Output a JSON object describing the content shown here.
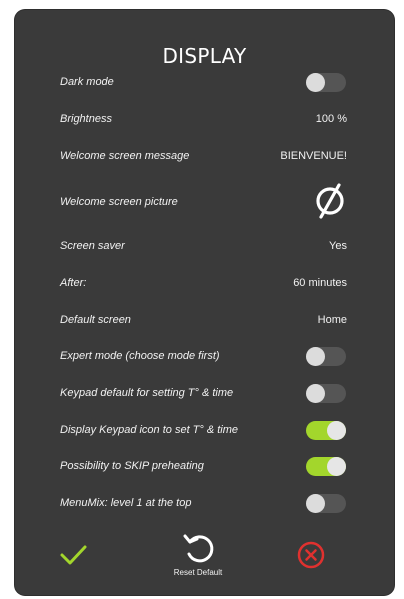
{
  "title": "DISPLAY",
  "colors": {
    "panel_bg": "#3a3a3a",
    "toggle_on": "#a3d62c",
    "toggle_off": "#555555",
    "confirm": "#a3d62c",
    "cancel": "#e0312f"
  },
  "settings": [
    {
      "label": "Dark mode",
      "type": "toggle",
      "on": false
    },
    {
      "label": "Brightness",
      "type": "value",
      "value": "100 %"
    },
    {
      "label": "Welcome screen message",
      "type": "value",
      "value": "BIENVENUE!"
    },
    {
      "label": "Welcome screen picture",
      "type": "icon",
      "icon": "empty-set-icon"
    },
    {
      "label": "Screen saver",
      "type": "value",
      "value": "Yes"
    },
    {
      "label": "After:",
      "type": "value",
      "value": "60 minutes"
    },
    {
      "label": "Default screen",
      "type": "value",
      "value": "Home"
    },
    {
      "label": "Expert mode (choose mode first)",
      "type": "toggle",
      "on": false
    },
    {
      "label": "Keypad default for setting T° & time",
      "type": "toggle",
      "on": false
    },
    {
      "label": "Display Keypad icon to set T° & time",
      "type": "toggle",
      "on": true
    },
    {
      "label": "Possibility to SKIP preheating",
      "type": "toggle",
      "on": true
    },
    {
      "label": "MenuMix: level 1 at the top",
      "type": "toggle",
      "on": false
    }
  ],
  "footer": {
    "confirm_icon": "checkmark-icon",
    "reset_icon": "reset-arrow-icon",
    "reset_label": "Reset Default",
    "cancel_icon": "close-circle-icon"
  }
}
